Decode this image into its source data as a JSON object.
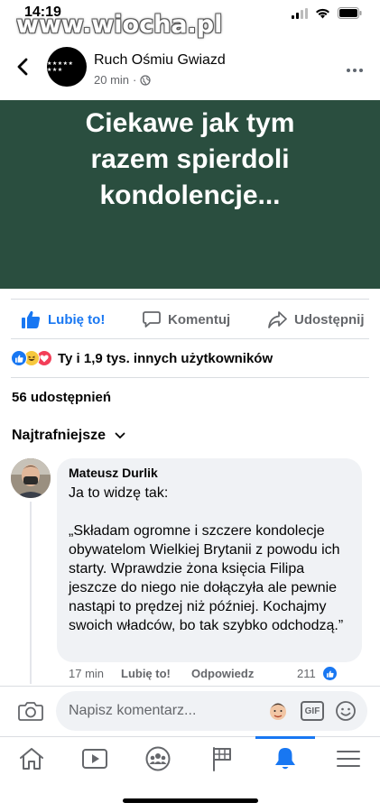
{
  "status_bar": {
    "time": "14:19",
    "watermark": "www.wiocha.pl"
  },
  "post_header": {
    "page_name": "Ruch Ośmiu Gwiazd",
    "avatar_text": "★★★★★ ★★★",
    "time": "20 min"
  },
  "post_image": {
    "text": "Ciekawe jak tym razem spierdoli kondolencje..."
  },
  "actions": {
    "like": "Lubię to!",
    "comment": "Komentuj",
    "share": "Udostępnij"
  },
  "reactions": {
    "summary": "Ty i 1,9 tys. innych użytkowników"
  },
  "shares": "56 udostępnień",
  "sort": {
    "label": "Najtrafniejsze"
  },
  "comment": {
    "author": "Mateusz Durlik",
    "body": "Ja to widzę tak:\n\n„Składam ogromne i szczere kondolecje obywatelom Wielkiej Brytanii z powodu ich starty. Wprawdzie żona księcia Filipa jeszcze do niego nie dołączyła ale pewnie nastąpi to prędzej niż później. Kochajmy swoich władców, bo tak szybko odchodzą.”",
    "time": "17 min",
    "like": "Lubię to!",
    "reply": "Odpowiedz",
    "reaction_count": "211"
  },
  "composer": {
    "placeholder": "Napisz komentarz..."
  },
  "colors": {
    "brand": "#1877f2",
    "image_bg": "#2a4e3f",
    "bubble_bg": "#f0f2f5"
  },
  "tabs": [
    "home-icon",
    "video-icon",
    "groups-icon",
    "pages-flag-icon",
    "notifications-bell-icon",
    "menu-icon"
  ]
}
